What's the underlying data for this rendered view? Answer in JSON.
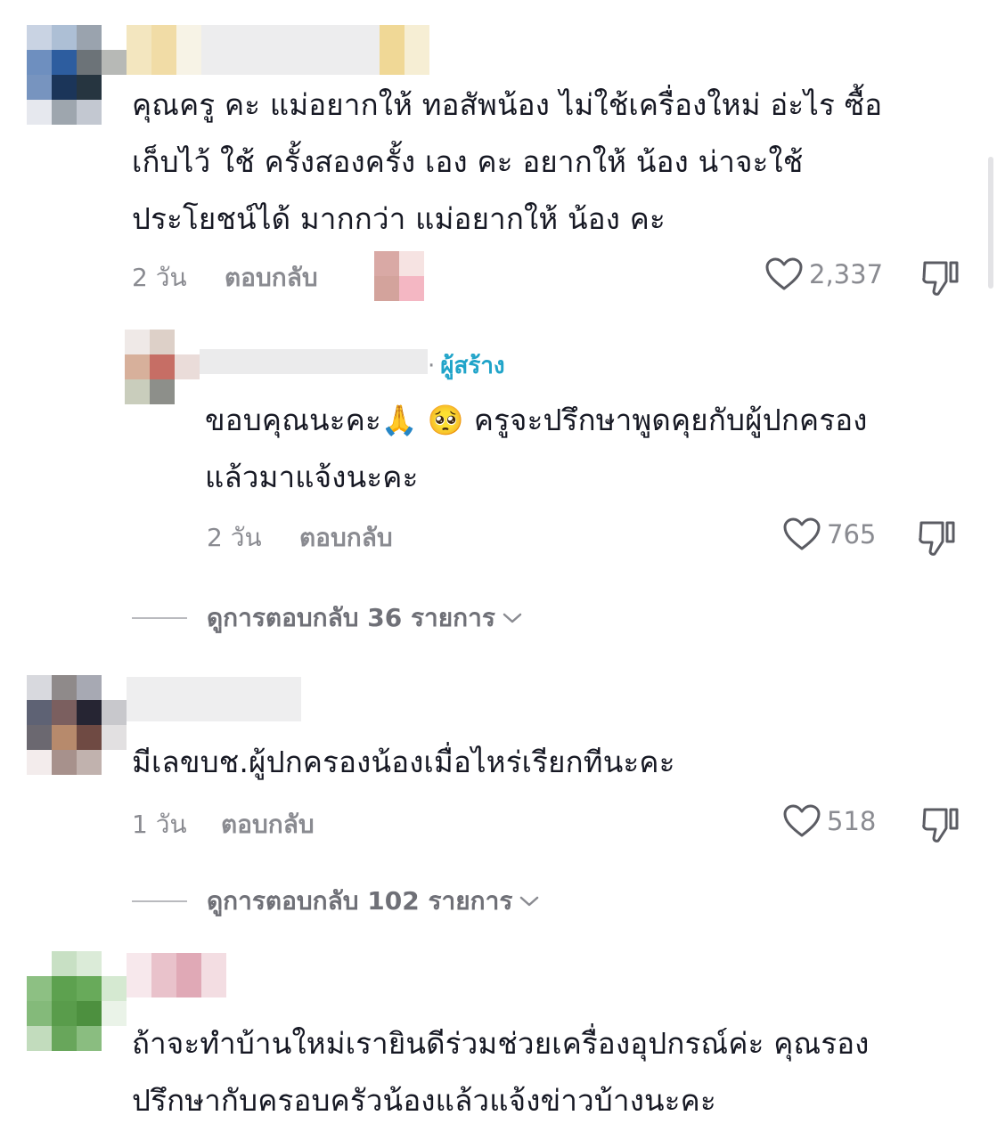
{
  "comments": [
    {
      "text": "คุณครู คะ แม่อยากให้ ทอสัพน้อง ไม่ใช้เครื่องใหม่ อ่ะไร ซื้อ\nเก็บไว้ ใช้ ครั้งสองครั้ง เอง คะ อยากให้ น้อง น่าจะใช้\nประโยชน์ได้ มากกว่า แม่อยากให้ น้อง คะ",
      "time": "2 วัน",
      "reply_label": "ตอบกลับ",
      "likes": "2,337"
    },
    {
      "creator_tag": "ผู้สร้าง",
      "text": "ขอบคุณนะคะ🙏 🥺 ครูจะปรึกษาพูดคุยกับผู้ปกครอง\nแล้วมาแจ้งนะคะ",
      "time": "2 วัน",
      "reply_label": "ตอบกลับ",
      "likes": "765",
      "view_replies": "ดูการตอบกลับ 36 รายการ"
    },
    {
      "text": "มีเลขบช.ผู้ปกครองน้องเมื่อไหร่เรียกทีนะคะ",
      "time": "1 วัน",
      "reply_label": "ตอบกลับ",
      "likes": "518",
      "view_replies": "ดูการตอบกลับ 102 รายการ"
    },
    {
      "text": "ถ้าจะทำบ้านใหม่เรายินดีร่วมช่วยเครื่องอุปกรณ์ค่ะ คุณรอง\nปรึกษากับครอบครัวน้องแล้วแจ้งข่าวบ้างนะคะ"
    }
  ],
  "icons": {
    "like": "heart-outline-icon",
    "dislike": "thumbs-down-icon",
    "expand": "chevron-down-icon"
  },
  "colors": {
    "text": "#161823",
    "muted": "#8a8b91",
    "creator": "#20a4c9"
  }
}
